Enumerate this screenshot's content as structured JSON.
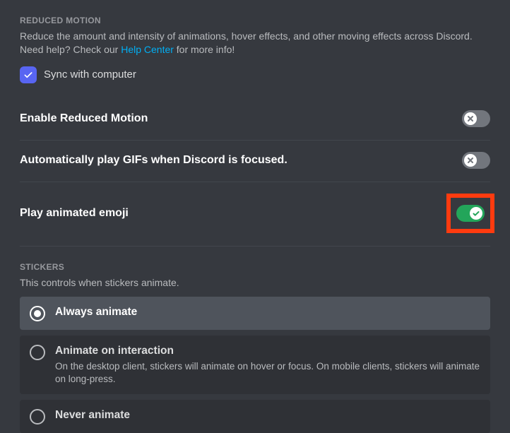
{
  "reducedMotion": {
    "header": "REDUCED MOTION",
    "desc_before": "Reduce the amount and intensity of animations, hover effects, and other moving effects across Discord. Need help? Check our ",
    "help_link": "Help Center",
    "desc_after": " for more info!",
    "sync_label": "Sync with computer",
    "sync_checked": true,
    "toggles": {
      "enable": {
        "label": "Enable Reduced Motion",
        "on": false
      },
      "gifs": {
        "label": "Automatically play GIFs when Discord is focused.",
        "on": false
      },
      "emoji": {
        "label": "Play animated emoji",
        "on": true,
        "highlighted": true
      }
    }
  },
  "stickers": {
    "header": "STICKERS",
    "desc": "This controls when stickers animate.",
    "options": [
      {
        "title": "Always animate",
        "desc": "",
        "selected": true
      },
      {
        "title": "Animate on interaction",
        "desc": "On the desktop client, stickers will animate on hover or focus. On mobile clients, stickers will animate on long-press.",
        "selected": false
      },
      {
        "title": "Never animate",
        "desc": "",
        "selected": false
      }
    ]
  }
}
